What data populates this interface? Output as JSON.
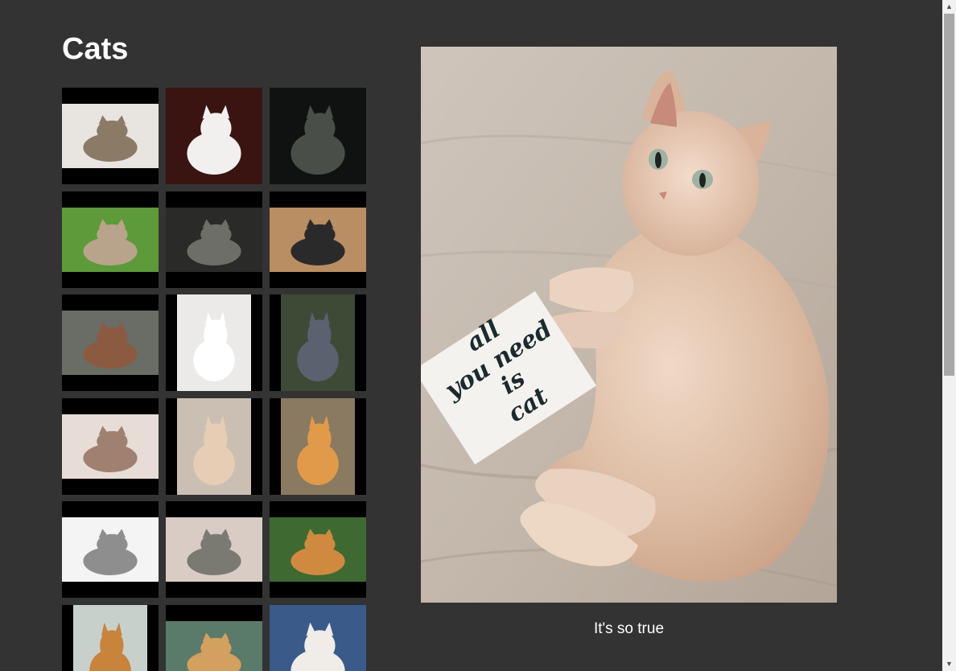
{
  "page": {
    "title": "Cats"
  },
  "viewer": {
    "caption": "It's so true",
    "card_text": [
      "all",
      "you need",
      "is",
      "cat"
    ]
  },
  "gallery": {
    "thumbnails": [
      {
        "orientation": "landscape",
        "bg": "#e8e4df",
        "subject": "#8a7a66"
      },
      {
        "orientation": "square",
        "bg": "#3a1410",
        "subject": "#f2f0ee"
      },
      {
        "orientation": "square",
        "bg": "#0f1210",
        "subject": "#4a4e48"
      },
      {
        "orientation": "landscape",
        "bg": "#5c9a3a",
        "subject": "#b8a48a"
      },
      {
        "orientation": "landscape",
        "bg": "#2a2a28",
        "subject": "#6e6e68"
      },
      {
        "orientation": "landscape",
        "bg": "#b88e62",
        "subject": "#2a2a2a"
      },
      {
        "orientation": "landscape",
        "bg": "#6a6c66",
        "subject": "#8c5a40"
      },
      {
        "orientation": "portrait",
        "bg": "#eceae8",
        "subject": "#ffffff"
      },
      {
        "orientation": "portrait",
        "bg": "#3e4a36",
        "subject": "#5a6270"
      },
      {
        "orientation": "landscape",
        "bg": "#e8dcd6",
        "subject": "#a08070"
      },
      {
        "orientation": "portrait",
        "bg": "#cbbfb4",
        "subject": "#e6cdb4"
      },
      {
        "orientation": "portrait",
        "bg": "#8a7a62",
        "subject": "#e09a4a"
      },
      {
        "orientation": "landscape",
        "bg": "#f4f4f4",
        "subject": "#8e8e8e"
      },
      {
        "orientation": "landscape",
        "bg": "#d8ccc4",
        "subject": "#7a7a72"
      },
      {
        "orientation": "landscape",
        "bg": "#3e6a32",
        "subject": "#d08a40"
      },
      {
        "orientation": "portrait",
        "bg": "#c8d0cc",
        "subject": "#c8843a"
      },
      {
        "orientation": "landscape",
        "bg": "#5a7a6a",
        "subject": "#d4a060"
      },
      {
        "orientation": "square",
        "bg": "#3a5a8a",
        "subject": "#f0ece8"
      }
    ]
  },
  "colors": {
    "page_bg": "#333333",
    "thumb_frame": "#000000",
    "text": "#ffffff"
  }
}
